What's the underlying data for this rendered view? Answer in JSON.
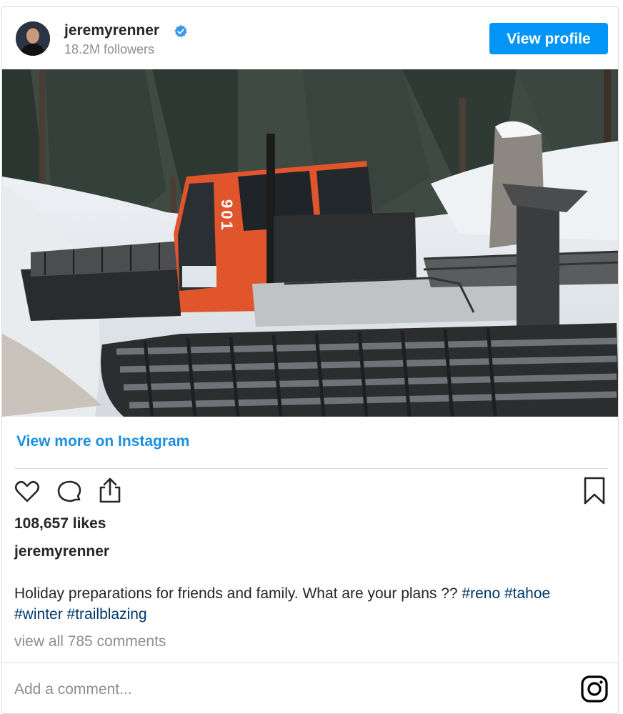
{
  "header": {
    "username": "jeremyrenner",
    "followers": "18.2M followers",
    "view_profile_label": "View profile"
  },
  "links": {
    "view_more": "View more on Instagram"
  },
  "actions": {
    "icons": [
      "heart-icon",
      "comment-icon",
      "share-icon",
      "bookmark-icon"
    ]
  },
  "post": {
    "likes": "108,657 likes",
    "caption_user": "jeremyrenner",
    "caption_text": "Holiday preparations for friends and family. What are your plans ?? ",
    "hashtags": [
      "#reno",
      "#tahoe",
      "#winter",
      "#trailblazing"
    ],
    "comments_link": "view all 785 comments",
    "vehicle_number": "901"
  },
  "comment": {
    "placeholder": "Add a comment..."
  },
  "colors": {
    "accent": "#0095f6",
    "link": "#1a8fe0",
    "hashtag": "#00376b",
    "muted": "#8e8e8e",
    "verified": "#3897f0",
    "vehicle": "#e0552b"
  }
}
